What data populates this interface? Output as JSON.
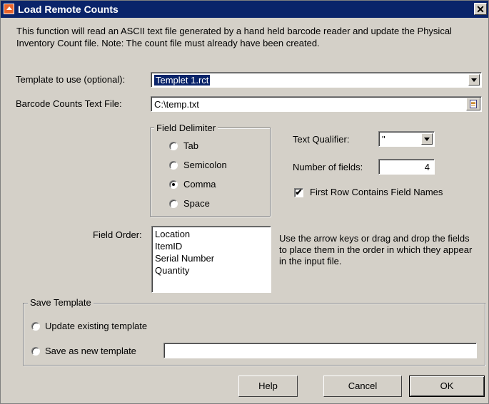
{
  "title": "Load Remote Counts",
  "close_glyph": "✕",
  "description": "This function will read an ASCII text file generated by a hand held barcode reader and update the Physical Inventory Count file. Note: The count file must already have been created.",
  "template": {
    "label": "Template to use (optional):",
    "value": "Templet 1.rct"
  },
  "barcode_file": {
    "label": "Barcode Counts Text File:",
    "value": "C:\\temp.txt"
  },
  "field_delimiter": {
    "legend": "Field Delimiter",
    "options": [
      "Tab",
      "Semicolon",
      "Comma",
      "Space"
    ],
    "selected": "Comma"
  },
  "text_qualifier": {
    "label": "Text Qualifier:",
    "value": "\""
  },
  "number_of_fields": {
    "label": "Number of fields:",
    "value": "4"
  },
  "first_row": {
    "label": "First Row Contains Field Names",
    "checked": true,
    "mark": "✔"
  },
  "field_order": {
    "label": "Field Order:",
    "items": [
      "Location",
      "ItemID",
      "Serial Number",
      "Quantity"
    ],
    "hint": "Use the arrow keys or drag and drop the fields to place them in the order in which they appear in the input file."
  },
  "save_template": {
    "legend": "Save Template",
    "update_label": "Update existing template",
    "save_new_label": "Save as new template",
    "new_name_value": ""
  },
  "buttons": {
    "help": "Help",
    "cancel": "Cancel",
    "ok": "OK"
  }
}
